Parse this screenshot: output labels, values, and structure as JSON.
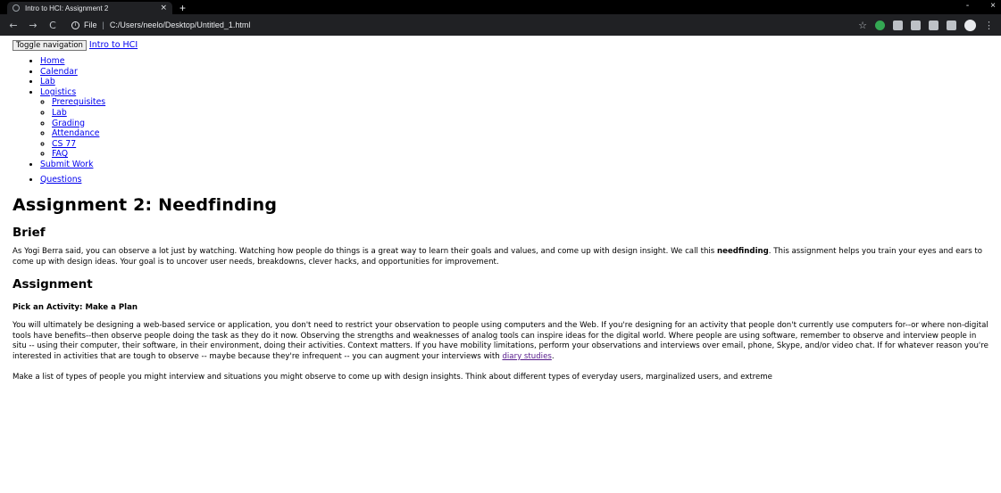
{
  "browser": {
    "tab_title": "Intro to HCI: Assignment 2",
    "tab_close": "×",
    "new_tab": "+",
    "window_controls": [
      "-",
      "×"
    ],
    "nav": {
      "back": "←",
      "forward": "→",
      "reload": "C"
    },
    "address_prefix": "File",
    "address": "C:/Users/neelo/Desktop/Untitled_1.html",
    "bookmark_star": "☆",
    "menu": "⋮",
    "icons": [
      "info-icon",
      "bookmark-star-icon",
      "grammarly-extension-icon",
      "extension-icon",
      "extension-icon",
      "puzzle-extension-icon",
      "playlist-icon",
      "profile-avatar-icon",
      "menu-icon"
    ]
  },
  "page": {
    "toggle_label": "Toggle navigation",
    "brand": "Intro to HCI",
    "nav": {
      "home": "Home",
      "calendar": "Calendar",
      "lab": "Lab",
      "logistics": "Logistics",
      "logistics_sub": {
        "prerequisites": "Prerequisites",
        "lab": "Lab",
        "grading": "Grading",
        "attendance": "Attendance",
        "cs77": "CS 77",
        "faq": "FAQ"
      },
      "submit_work": "Submit Work",
      "questions": "Questions"
    },
    "title": "Assignment 2: Needfinding",
    "brief_heading": "Brief",
    "brief": {
      "before": "As Yogi Berra said, you can observe a lot just by watching. Watching how people do things is a great way to learn their goals and values, and come up with design insight. We call this ",
      "bold": "needfinding",
      "after": ". This assignment helps you train your eyes and ears to come up with design ideas. Your goal is to uncover user needs, breakdowns, clever hacks, and opportunities for improvement."
    },
    "assignment_heading": "Assignment",
    "activity_heading": "Pick an Activity: Make a Plan",
    "activity_para": {
      "text": "You will ultimately be designing a web-based service or application, you don't need to restrict your observation to people using computers and the Web. If you're designing for an activity that people don't currently use computers for--or where non-digital tools have benefits--then observe people doing the task as they do it now. Observing the strengths and weaknesses of analog tools can inspire ideas for the digital world. Where people are using software, remember to observe and interview people in situ -- using their computer, their software, in their environment, doing their activities. Context matters. If you have mobility limitations, perform your observations and interviews over email, phone, Skype, and/or video chat. If for whatever reason you're interested in activities that are tough to observe -- maybe because they're infrequent -- you can augment your interviews with ",
      "link": "diary studies",
      "end": "."
    },
    "list_para": "Make a list of types of people you might interview and situations you might observe to come up with design insights. Think about different types of everyday users, marginalized users, and extreme"
  }
}
